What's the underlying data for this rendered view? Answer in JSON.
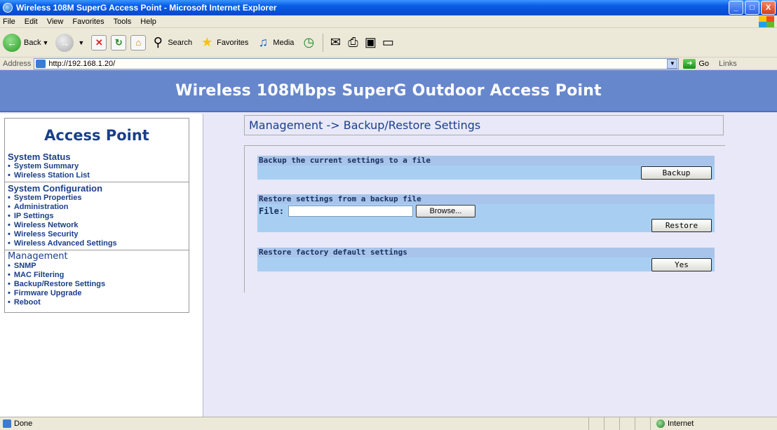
{
  "window": {
    "title": "Wireless 108M SuperG Access Point - Microsoft Internet Explorer",
    "buttons": {
      "minimize": "_",
      "maximize": "□",
      "close": "X"
    }
  },
  "menu": [
    "File",
    "Edit",
    "View",
    "Favorites",
    "Tools",
    "Help"
  ],
  "toolbar": {
    "back": "Back",
    "search": "Search",
    "favorites": "Favorites",
    "media": "Media"
  },
  "address": {
    "label": "Address",
    "url": "http://192.168.1.20/",
    "go": "Go",
    "links": "Links"
  },
  "banner": {
    "title": "Wireless 108Mbps SuperG Outdoor Access Point"
  },
  "sidebar": {
    "heading": "Access Point",
    "sections": [
      {
        "title": "System Status",
        "items": [
          "System Summary",
          "Wireless Station List"
        ]
      },
      {
        "title": "System Configuration",
        "items": [
          "System Properties",
          "Administration",
          "IP Settings",
          "Wireless Network",
          "Wireless Security",
          "Wireless Advanced Settings"
        ]
      },
      {
        "title": "Management",
        "items": [
          "SNMP",
          "MAC Filtering",
          "Backup/Restore Settings",
          "Firmware Upgrade",
          "Reboot"
        ]
      }
    ]
  },
  "main": {
    "breadcrumb": "Management -> Backup/Restore Settings",
    "backup": {
      "header": "Backup the current settings to a file",
      "button": "Backup"
    },
    "restore": {
      "header": "Restore settings from a backup file",
      "file_label": "File:",
      "file_value": "",
      "browse": "Browse...",
      "button": "Restore"
    },
    "factory": {
      "header": "Restore factory default settings",
      "button": "Yes"
    }
  },
  "status": {
    "text": "Done",
    "zone": "Internet"
  }
}
